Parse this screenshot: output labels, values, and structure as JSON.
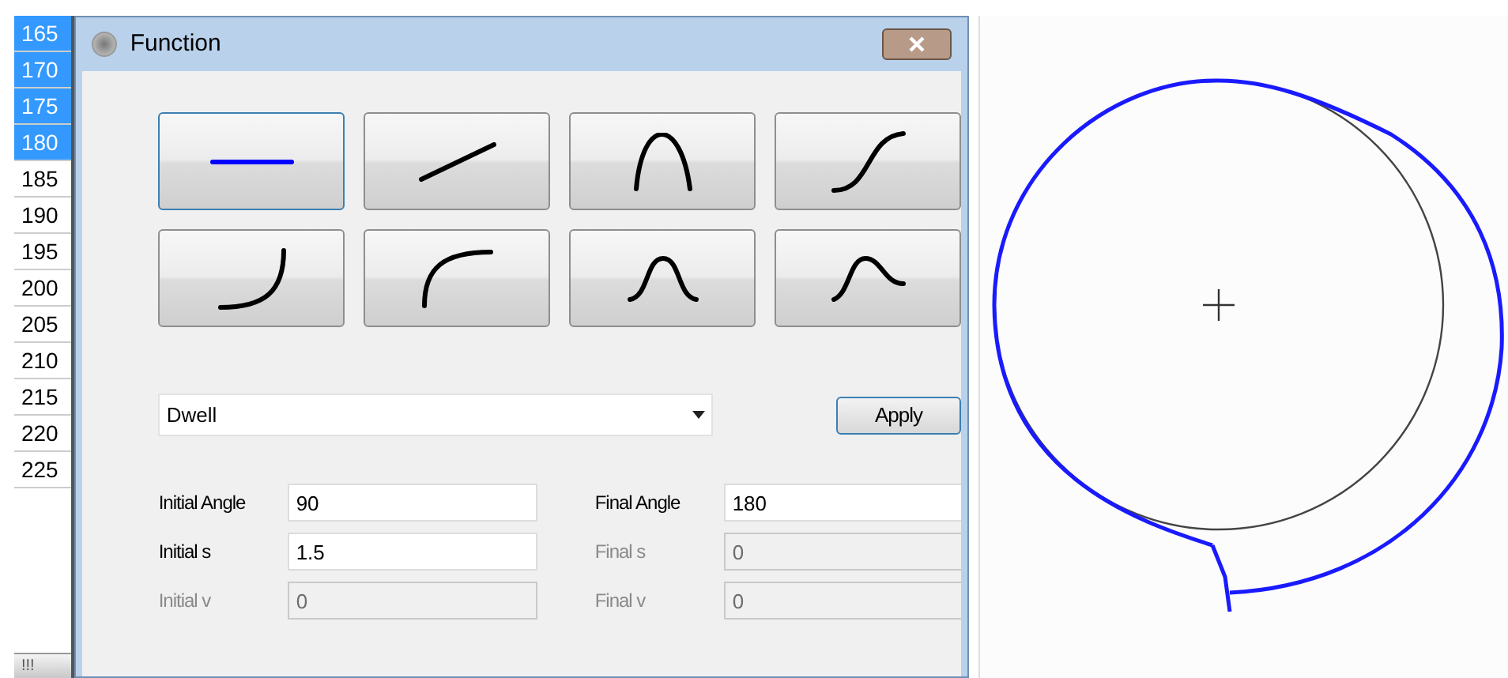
{
  "angle_list": [
    {
      "label": "165",
      "selected": true
    },
    {
      "label": "170",
      "selected": true
    },
    {
      "label": "175",
      "selected": true
    },
    {
      "label": "180",
      "selected": true
    },
    {
      "label": "185",
      "selected": false
    },
    {
      "label": "190",
      "selected": false
    },
    {
      "label": "195",
      "selected": false
    },
    {
      "label": "200",
      "selected": false
    },
    {
      "label": "205",
      "selected": false
    },
    {
      "label": "210",
      "selected": false
    },
    {
      "label": "215",
      "selected": false
    },
    {
      "label": "220",
      "selected": false
    },
    {
      "label": "225",
      "selected": false
    }
  ],
  "list_scroll_handle": "!!!",
  "dialog": {
    "title": "Function",
    "function_buttons": [
      {
        "kind": "flat",
        "selected": true
      },
      {
        "kind": "ramp",
        "selected": false
      },
      {
        "kind": "arch",
        "selected": false
      },
      {
        "kind": "rise",
        "selected": false
      },
      {
        "kind": "concave",
        "selected": false
      },
      {
        "kind": "convex",
        "selected": false
      },
      {
        "kind": "bell",
        "selected": false
      },
      {
        "kind": "skewed-bell",
        "selected": false
      }
    ],
    "function_select": {
      "value": "Dwell"
    },
    "apply_button": "Apply",
    "fields": [
      {
        "label": "Initial Angle",
        "value": "90",
        "disabled": false
      },
      {
        "label": "Final Angle",
        "value": "180",
        "disabled": false
      },
      {
        "label": "Initial s",
        "value": "1.5",
        "disabled": false
      },
      {
        "label": "Final s",
        "value": "0",
        "disabled": true
      },
      {
        "label": "Initial v",
        "value": "0",
        "disabled": true
      },
      {
        "label": "Final v",
        "value": "0",
        "disabled": true
      }
    ]
  }
}
